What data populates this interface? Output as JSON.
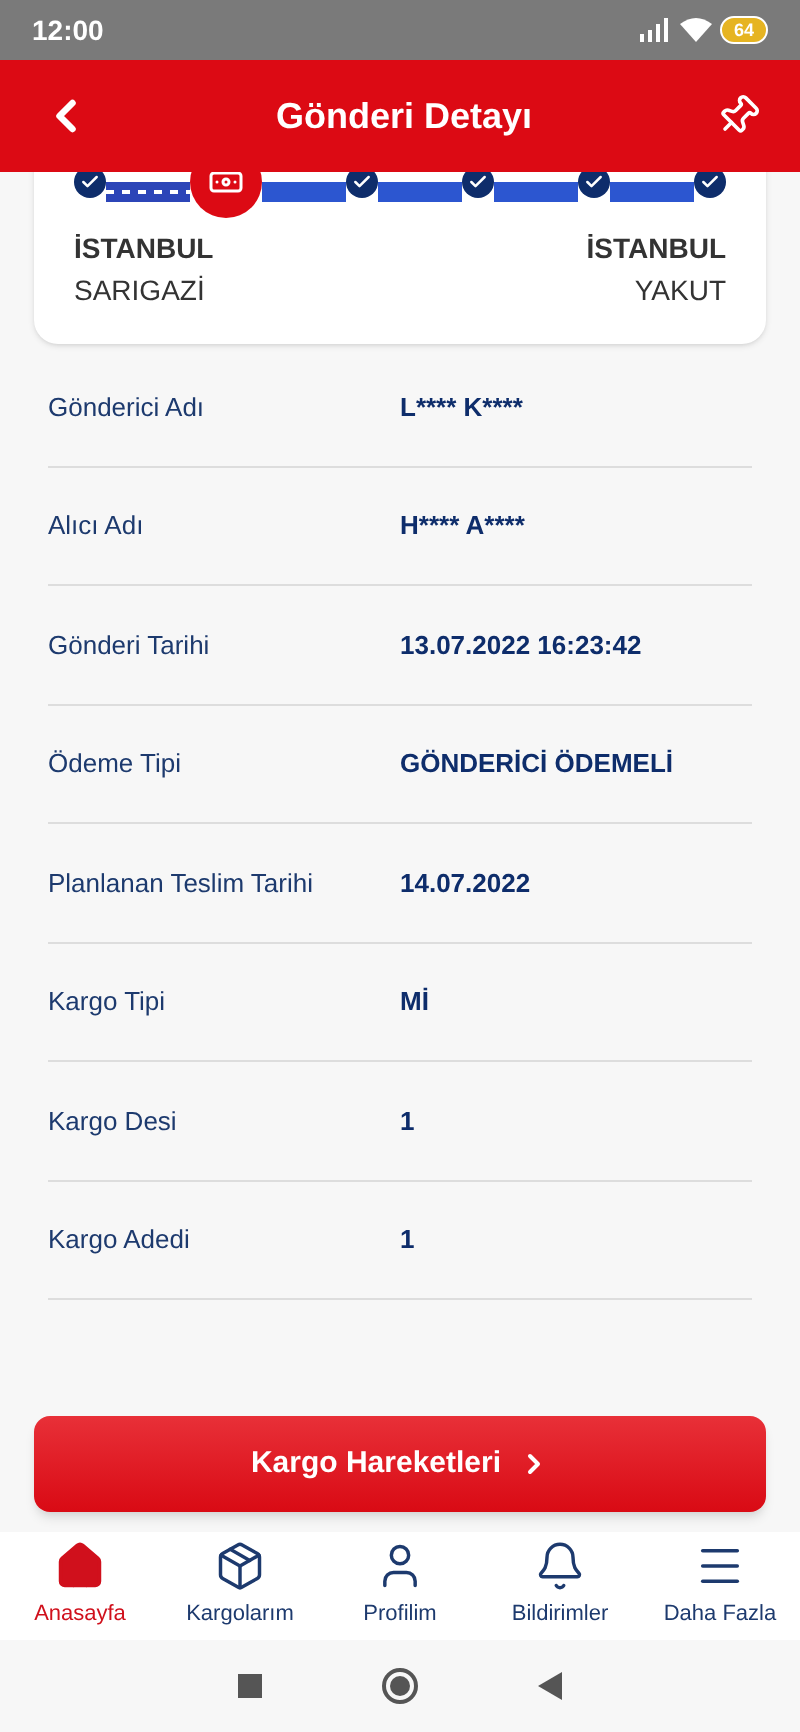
{
  "status_bar": {
    "time": "12:00",
    "battery": "64"
  },
  "header": {
    "title": "Gönderi Detayı"
  },
  "tracker": {
    "steps": [
      {
        "kind": "done"
      },
      {
        "kind": "current"
      },
      {
        "kind": "done"
      },
      {
        "kind": "done"
      },
      {
        "kind": "done"
      },
      {
        "kind": "done"
      }
    ],
    "origin": {
      "city": "İSTANBUL",
      "district": "SARIGAZİ"
    },
    "destination": {
      "city": "İSTANBUL",
      "district": "YAKUT"
    }
  },
  "details": [
    {
      "label": "Gönderici Adı",
      "value": "L**** K****"
    },
    {
      "label": "Alıcı Adı",
      "value": "H**** A****"
    },
    {
      "label": "Gönderi Tarihi",
      "value": "13.07.2022 16:23:42"
    },
    {
      "label": "Ödeme Tipi",
      "value": "GÖNDERİCİ ÖDEMELİ"
    },
    {
      "label": "Planlanan Teslim Tarihi",
      "value": "14.07.2022"
    },
    {
      "label": "Kargo Tipi",
      "value": "Mİ"
    },
    {
      "label": "Kargo Desi",
      "value": "1"
    },
    {
      "label": "Kargo Adedi",
      "value": "1"
    }
  ],
  "action_button": {
    "label": "Kargo Hareketleri"
  },
  "bottom_nav": [
    {
      "label": "Anasayfa",
      "kind": "home",
      "selected": true
    },
    {
      "label": "Kargolarım",
      "kind": "package",
      "selected": false
    },
    {
      "label": "Profilim",
      "kind": "user",
      "selected": false
    },
    {
      "label": "Bildirimler",
      "kind": "bell",
      "selected": false
    },
    {
      "label": "Daha Fazla",
      "kind": "menu",
      "selected": false
    }
  ]
}
